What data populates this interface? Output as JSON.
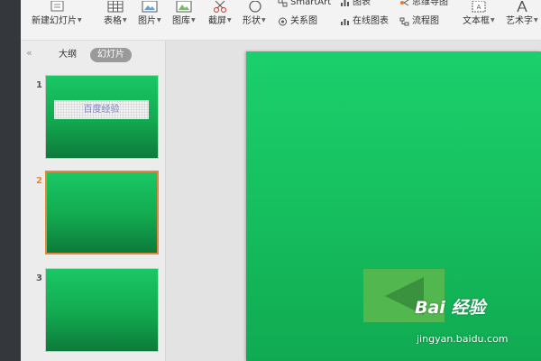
{
  "toolbar": {
    "new_slide": "新建幻灯片",
    "table": "表格",
    "picture": "图片",
    "gallery": "图库",
    "screenshot": "截屏",
    "shape": "形状",
    "smartart": "SmartArt",
    "chart": "图表",
    "mindmap": "思维导图",
    "relation": "关系图",
    "online_chart": "在线图表",
    "flowchart": "流程图",
    "textbox": "文本框",
    "wordart": "艺术字"
  },
  "side_panel": {
    "collapse": "«",
    "tabs": [
      {
        "label": "大纲",
        "active": false
      },
      {
        "label": "幻灯片",
        "active": true
      }
    ],
    "slides": [
      {
        "number": "1",
        "text": "百度经验"
      },
      {
        "number": "2",
        "text": ""
      },
      {
        "number": "3",
        "text": ""
      }
    ]
  },
  "watermark": {
    "logo": "Bai 经验",
    "sub": "jingyan.baidu.com"
  },
  "colors": {
    "slide_green": "#17c160",
    "active_border": "#e0893a",
    "tab_active_bg": "#9a9a9a"
  },
  "icons": {
    "new_slide": "new-slide-icon",
    "table": "table-icon",
    "picture": "picture-icon",
    "gallery": "gallery-icon",
    "screenshot": "scissors-icon",
    "shape": "shape-icon",
    "back": "triangle-left-icon"
  }
}
